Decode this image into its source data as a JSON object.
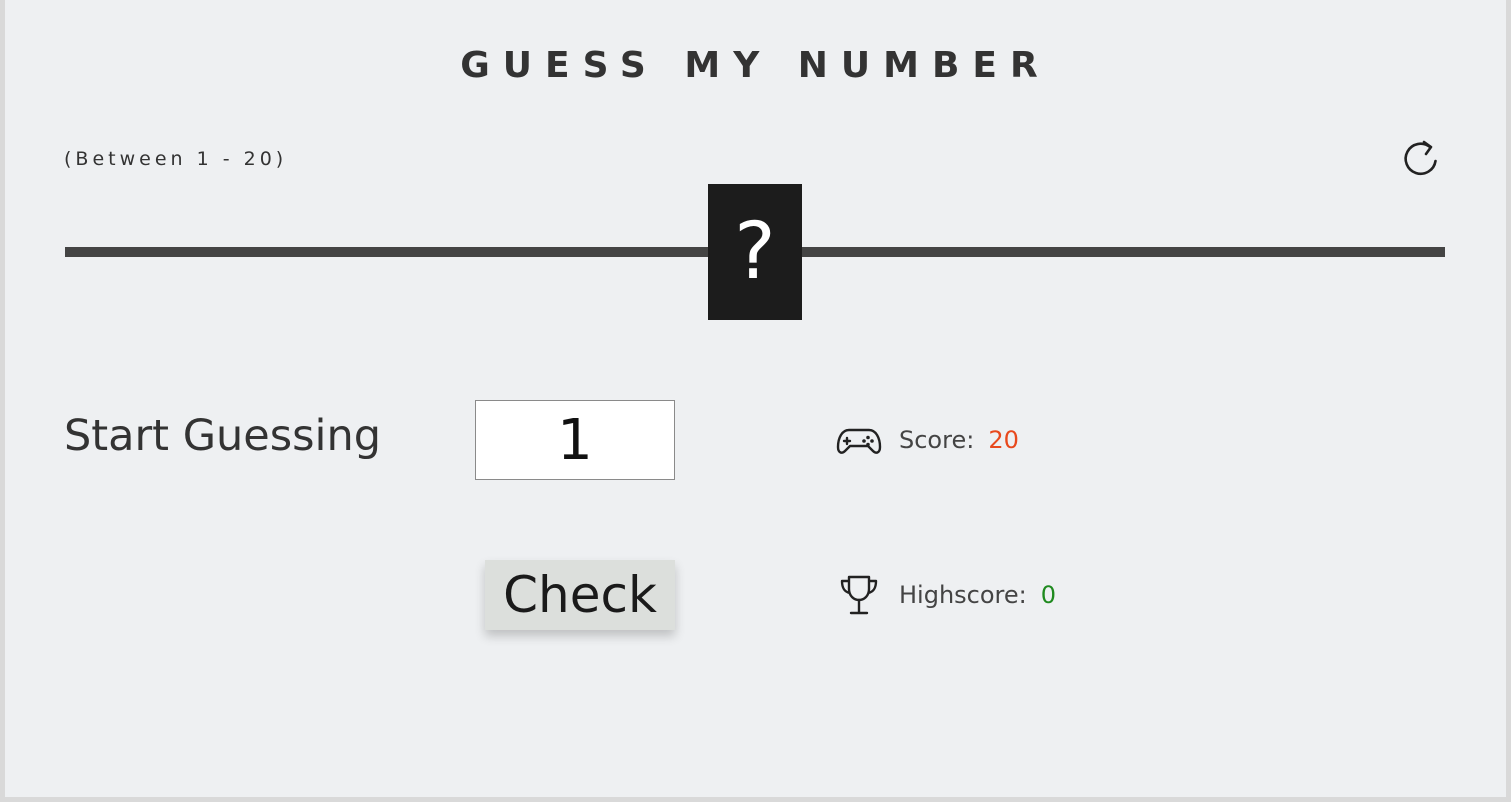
{
  "header": {
    "title": "GUESS MY NUMBER",
    "range_hint": "(Between 1 - 20)"
  },
  "secret": {
    "display": "?"
  },
  "controls": {
    "reset_icon": "refresh-icon",
    "prompt_label": "Start Guessing",
    "guess_value": "1",
    "check_label": "Check"
  },
  "stats": {
    "score": {
      "icon": "gamepad-icon",
      "label": "Score:",
      "value": "20"
    },
    "highscore": {
      "icon": "trophy-icon",
      "label": "Highscore:",
      "value": "0"
    }
  },
  "colors": {
    "background": "#eef0f2",
    "text": "#333333",
    "secret_box": "#1c1c1c",
    "score_value": "#e8491d",
    "highscore_value": "#1f8a1f"
  }
}
